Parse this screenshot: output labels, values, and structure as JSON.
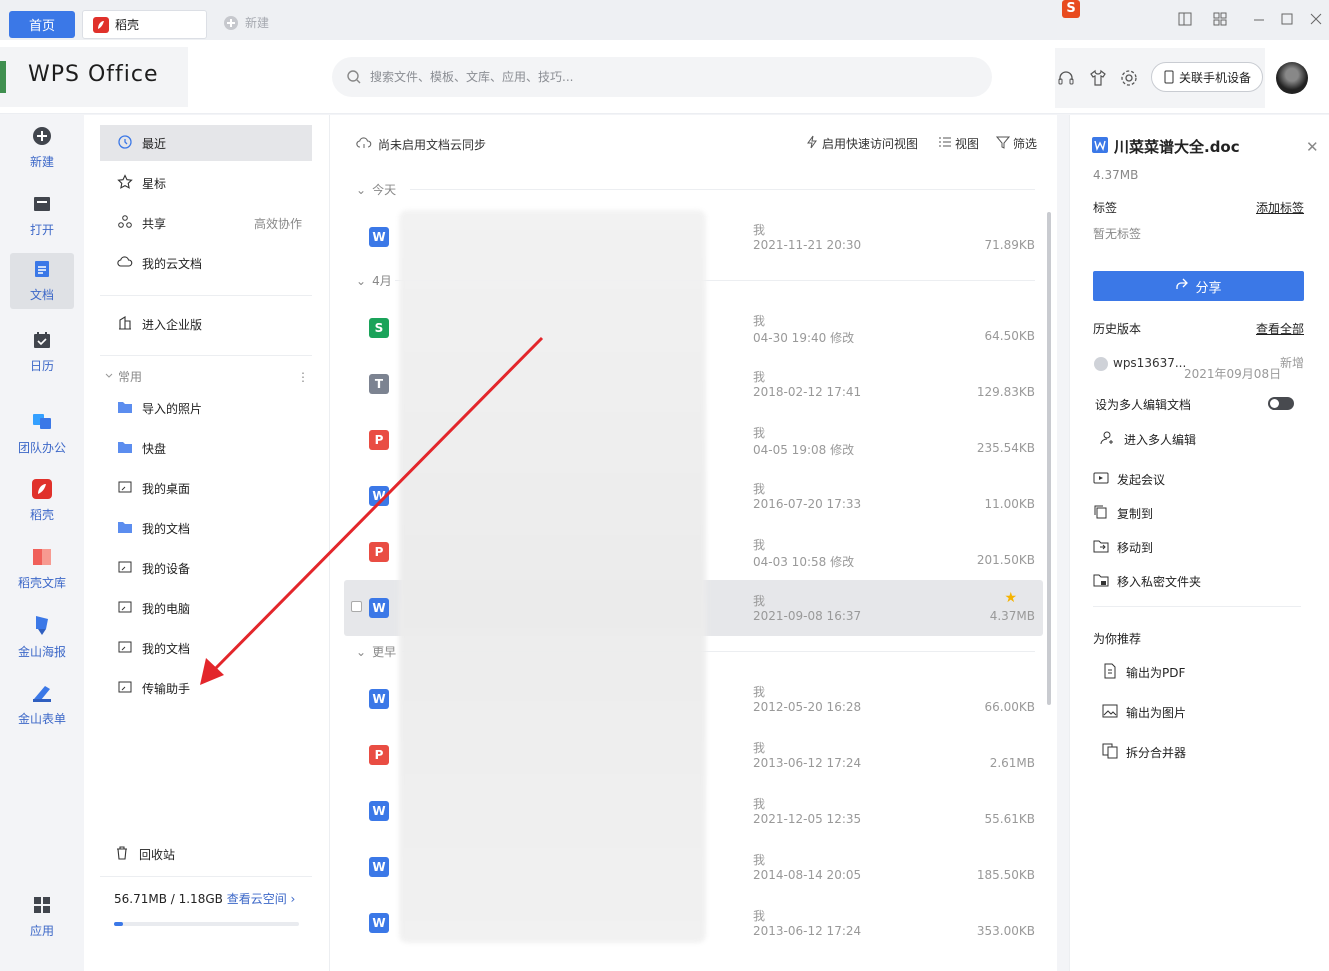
{
  "tabs": {
    "home": "首页",
    "daoke": "稻壳",
    "new": "新建"
  },
  "header": {
    "logo": "WPS Office",
    "search_placeholder": "搜索文件、模板、文库、应用、技巧...",
    "phone_button": "关联手机设备"
  },
  "leftnav": [
    {
      "label": "新建",
      "icon": "plus-circle-icon"
    },
    {
      "label": "打开",
      "icon": "folder-open-icon"
    },
    {
      "label": "文档",
      "icon": "document-icon",
      "active": true
    },
    {
      "label": "日历",
      "icon": "calendar-icon"
    },
    {
      "label": "团队办公",
      "icon": "team-office-icon"
    },
    {
      "label": "稻壳",
      "icon": "daoke-icon"
    },
    {
      "label": "稻壳文库",
      "icon": "daoke-library-icon"
    },
    {
      "label": "金山海报",
      "icon": "poster-icon"
    },
    {
      "label": "金山表单",
      "icon": "form-icon"
    },
    {
      "label": "应用",
      "icon": "apps-grid-icon"
    }
  ],
  "panel": {
    "recent": "最近",
    "starred": "星标",
    "shared": "共享",
    "shared_side": "高效协作",
    "cloud": "我的云文档",
    "enterprise": "进入企业版",
    "common": "常用",
    "common_items": [
      "导入的照片",
      "快盘",
      "我的桌面",
      "我的文档",
      "我的设备",
      "我的电脑",
      "我的文档",
      "传输助手"
    ],
    "recycle": "回收站",
    "storage": "56.71MB / 1.18GB",
    "storage_link": "查看云空间 ›",
    "storage_fraction": 0.047
  },
  "main": {
    "sync": "尚未启用文档云同步",
    "quick_view": "启用快速访问视图",
    "view": "视图",
    "filter": "筛选",
    "groups": {
      "today": "今天",
      "april": "4月",
      "earlier": "更早"
    },
    "rows": [
      {
        "type": "W",
        "owner": "我",
        "time": "2021-11-21 20:30",
        "size": "71.89KB"
      },
      {
        "type": "S",
        "owner": "我",
        "time": "04-30 19:40 修改",
        "size": "64.50KB"
      },
      {
        "type": "T",
        "owner": "我",
        "time": "2018-02-12 17:41",
        "size": "129.83KB"
      },
      {
        "type": "P",
        "owner": "我",
        "time": "04-05 19:08 修改",
        "size": "235.54KB"
      },
      {
        "type": "W",
        "owner": "我",
        "time": "2016-07-20 17:33",
        "size": "11.00KB"
      },
      {
        "type": "P",
        "owner": "我",
        "time": "04-03 10:58 修改",
        "size": "201.50KB"
      },
      {
        "type": "W",
        "owner": "我",
        "time": "2021-09-08 16:37",
        "size": "4.37MB",
        "selected": true,
        "starred": true
      },
      {
        "type": "W",
        "owner": "我",
        "time": "2012-05-20 16:28",
        "size": "66.00KB"
      },
      {
        "type": "P",
        "owner": "我",
        "time": "2013-06-12 17:24",
        "size": "2.61MB"
      },
      {
        "type": "W",
        "owner": "我",
        "time": "2021-12-05 12:35",
        "size": "55.61KB"
      },
      {
        "type": "W",
        "owner": "我",
        "time": "2014-08-14 20:05",
        "size": "185.50KB"
      },
      {
        "type": "W",
        "owner": "我",
        "time": "2013-06-12 17:24",
        "size": "353.00KB"
      }
    ]
  },
  "detail": {
    "filename": "川菜菜谱大全.doc",
    "size": "4.37MB",
    "tags_label": "标签",
    "add_tag": "添加标签",
    "no_tags": "暂无标签",
    "share": "分享",
    "history_label": "历史版本",
    "view_all": "查看全部",
    "history_user": "wps13637...",
    "history_date": "2021年09月08日",
    "history_status": "新增",
    "multi_edit_label": "设为多人编辑文档",
    "enter_multi_edit": "进入多人编辑",
    "meeting": "发起会议",
    "copy_to": "复制到",
    "move_to": "移动到",
    "private_folder": "移入私密文件夹",
    "recommend": "为你推荐",
    "export_pdf": "输出为PDF",
    "export_image": "输出为图片",
    "split_merge": "拆分合并器"
  },
  "colors": {
    "accent": "#3b78e7",
    "arrow": "#e3262b",
    "word": "#3b78e7",
    "sheet": "#1aa35a",
    "pdf": "#e94d43",
    "text": "#7c8391"
  }
}
